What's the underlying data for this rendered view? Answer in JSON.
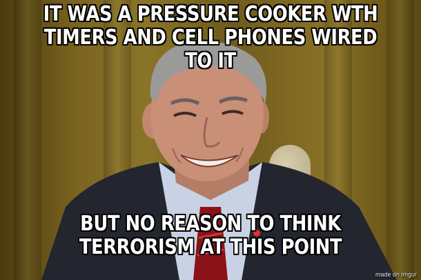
{
  "caption": {
    "top_line_1": "IT WAS A PRESSURE COOKER WTH",
    "top_line_2": "TIMERS AND CELL PHONES WIRED TO IT",
    "bottom_line_1": "BUT NO REASON TO THINK",
    "bottom_line_2": "TERRORISM AT THIS POINT"
  },
  "watermark": "made on imgur",
  "colors": {
    "curtain": "#7a6420",
    "suit": "#23262e",
    "shirt": "#c9d2e4",
    "tie": "#8a1218",
    "skin": "#c98f77",
    "hair": "#9a9a98"
  }
}
